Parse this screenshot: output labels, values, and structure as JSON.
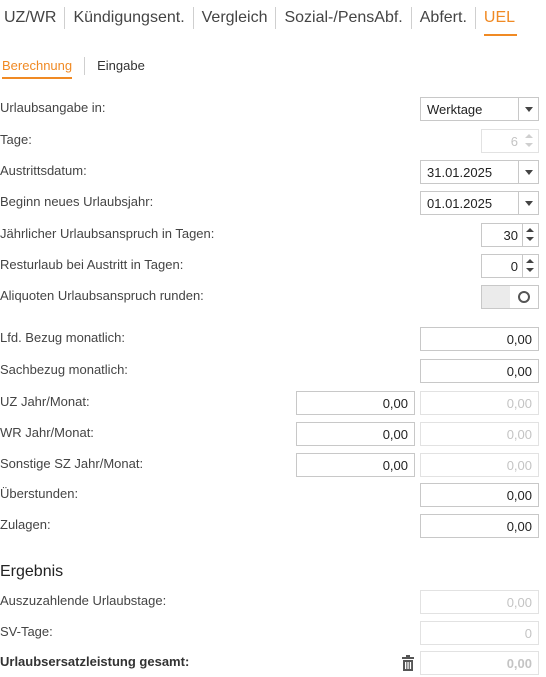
{
  "top_tabs": [
    {
      "label": "UZ/WR"
    },
    {
      "label": "Kündigungsent."
    },
    {
      "label": "Vergleich"
    },
    {
      "label": "Sozial-/PensAbf."
    },
    {
      "label": "Abfert."
    },
    {
      "label": "UEL"
    }
  ],
  "sub_tabs": [
    {
      "label": "Berechnung"
    },
    {
      "label": "Eingabe"
    }
  ],
  "form": {
    "urlaubsangabe": {
      "label": "Urlaubsangabe in:",
      "value": "Werktage"
    },
    "tage": {
      "label": "Tage:",
      "value": "6"
    },
    "austrittsdatum": {
      "label": "Austrittsdatum:",
      "value": "31.01.2025"
    },
    "beginn": {
      "label": "Beginn neues Urlaubsjahr:",
      "value": "01.01.2025"
    },
    "jaehrlich": {
      "label": "Jährlicher Urlaubsanspruch in Tagen:",
      "value": "30"
    },
    "resturlaub": {
      "label": "Resturlaub bei Austritt in Tagen:",
      "value": "0"
    },
    "aliquot": {
      "label": "Aliquoten Urlaubsanspruch runden:"
    }
  },
  "amounts": {
    "lfd": {
      "label": "Lfd. Bezug monatlich:",
      "value": "0,00"
    },
    "sachbezug": {
      "label": "Sachbezug monatlich:",
      "value": "0,00"
    },
    "uz": {
      "label": "UZ Jahr/Monat:",
      "year": "0,00",
      "month": "0,00"
    },
    "wr": {
      "label": "WR Jahr/Monat:",
      "year": "0,00",
      "month": "0,00"
    },
    "sonstige": {
      "label": "Sonstige SZ Jahr/Monat:",
      "year": "0,00",
      "month": "0,00"
    },
    "ueberstunden": {
      "label": "Überstunden:",
      "value": "0,00"
    },
    "zulagen": {
      "label": "Zulagen:",
      "value": "0,00"
    }
  },
  "result": {
    "title": "Ergebnis",
    "urlaubstage": {
      "label": "Auszuzahlende Urlaubstage:",
      "value": "0,00"
    },
    "sv_tage": {
      "label": "SV-Tage:",
      "value": "0"
    },
    "gesamt": {
      "label": "Urlaubsersatzleistung gesamt:",
      "value": "0,00"
    }
  },
  "icons": {
    "delete": "trash-icon"
  },
  "colors": {
    "accent": "#f08a24",
    "border": "#c8c8c8",
    "disabled_text": "#c4c4c4"
  }
}
